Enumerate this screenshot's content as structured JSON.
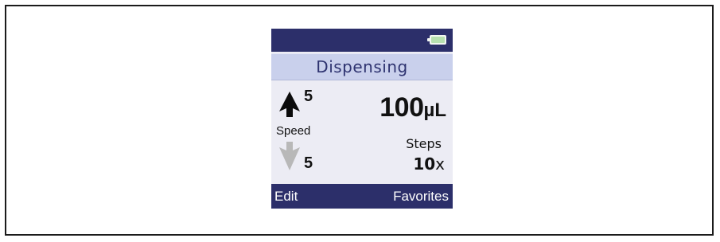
{
  "screen": {
    "title": "Dispensing",
    "battery_icon": "battery-full-icon"
  },
  "speed": {
    "label": "Speed",
    "aspirate_value": "5",
    "dispense_value": "5",
    "aspirate_icon": "arrow-up-icon",
    "dispense_icon": "arrow-down-icon"
  },
  "volume": {
    "value": "100",
    "unit": "µL"
  },
  "steps": {
    "label": "Steps",
    "value": "10",
    "suffix": "x"
  },
  "softkeys": {
    "left": "Edit",
    "right": "Favorites"
  },
  "colors": {
    "bar": "#2c2f6a",
    "title_band": "#c9d0ec",
    "screen_bg": "#ececf4",
    "title_text": "#2e3370",
    "dispense_arrow": "#b8b8b8"
  }
}
